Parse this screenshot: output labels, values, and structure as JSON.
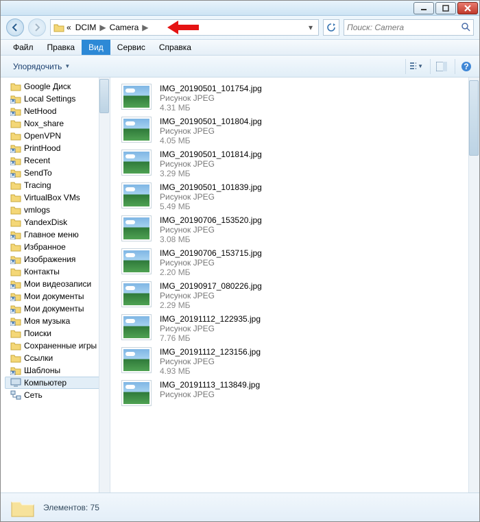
{
  "breadcrumb": {
    "lead": "«",
    "part1": "DCIM",
    "part2": "Camera"
  },
  "search": {
    "placeholder": "Поиск: Camera"
  },
  "menu": {
    "file": "Файл",
    "edit": "Правка",
    "view": "Вид",
    "tools": "Сервис",
    "help": "Справка"
  },
  "toolbar": {
    "organize": "Упорядочить"
  },
  "tree": {
    "items": [
      {
        "label": "Google Диск",
        "icon": "folder"
      },
      {
        "label": "Local Settings",
        "icon": "shortcut"
      },
      {
        "label": "NetHood",
        "icon": "shortcut"
      },
      {
        "label": "Nox_share",
        "icon": "folder"
      },
      {
        "label": "OpenVPN",
        "icon": "folder"
      },
      {
        "label": "PrintHood",
        "icon": "shortcut"
      },
      {
        "label": "Recent",
        "icon": "shortcut"
      },
      {
        "label": "SendTo",
        "icon": "shortcut"
      },
      {
        "label": "Tracing",
        "icon": "folder"
      },
      {
        "label": "VirtualBox VMs",
        "icon": "folder"
      },
      {
        "label": "vmlogs",
        "icon": "folder"
      },
      {
        "label": "YandexDisk",
        "icon": "folder"
      },
      {
        "label": "Главное меню",
        "icon": "shortcut"
      },
      {
        "label": "Избранное",
        "icon": "folder"
      },
      {
        "label": "Изображения",
        "icon": "shortcut"
      },
      {
        "label": "Контакты",
        "icon": "folder"
      },
      {
        "label": "Мои видеозаписи",
        "icon": "shortcut"
      },
      {
        "label": "Мои документы",
        "icon": "shortcut"
      },
      {
        "label": "Мои документы",
        "icon": "shortcut"
      },
      {
        "label": "Моя музыка",
        "icon": "shortcut"
      },
      {
        "label": "Поиски",
        "icon": "folder"
      },
      {
        "label": "Сохраненные игры",
        "icon": "folder"
      },
      {
        "label": "Ссылки",
        "icon": "folder"
      },
      {
        "label": "Шаблоны",
        "icon": "shortcut"
      },
      {
        "label": "Компьютер",
        "icon": "computer",
        "selected": true
      },
      {
        "label": "Сеть",
        "icon": "network"
      }
    ]
  },
  "files": [
    {
      "name": "IMG_20190501_101754.jpg",
      "type": "Рисунок JPEG",
      "size": "4.31 МБ"
    },
    {
      "name": "IMG_20190501_101804.jpg",
      "type": "Рисунок JPEG",
      "size": "4.05 МБ"
    },
    {
      "name": "IMG_20190501_101814.jpg",
      "type": "Рисунок JPEG",
      "size": "3.29 МБ"
    },
    {
      "name": "IMG_20190501_101839.jpg",
      "type": "Рисунок JPEG",
      "size": "5.49 МБ"
    },
    {
      "name": "IMG_20190706_153520.jpg",
      "type": "Рисунок JPEG",
      "size": "3.08 МБ"
    },
    {
      "name": "IMG_20190706_153715.jpg",
      "type": "Рисунок JPEG",
      "size": "2.20 МБ"
    },
    {
      "name": "IMG_20190917_080226.jpg",
      "type": "Рисунок JPEG",
      "size": "2.29 МБ"
    },
    {
      "name": "IMG_20191112_122935.jpg",
      "type": "Рисунок JPEG",
      "size": "7.76 МБ"
    },
    {
      "name": "IMG_20191112_123156.jpg",
      "type": "Рисунок JPEG",
      "size": "4.93 МБ"
    },
    {
      "name": "IMG_20191113_113849.jpg",
      "type": "Рисунок JPEG",
      "size": ""
    }
  ],
  "status": {
    "label": "Элементов:",
    "count": "75"
  }
}
